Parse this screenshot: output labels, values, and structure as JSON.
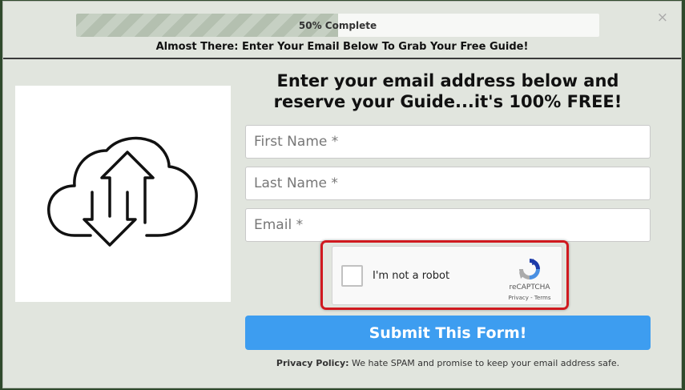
{
  "progress": {
    "label": "50% Complete",
    "percent": 50
  },
  "close_label": "×",
  "subtitle": "Almost There: Enter Your Email Below To Grab Your Free Guide!",
  "image": {
    "icon": "cloud-up-down-arrows-icon"
  },
  "headline": "Enter your email address below and reserve your Guide...it's 100% FREE!",
  "form": {
    "first_name_placeholder": "First Name *",
    "last_name_placeholder": "Last Name *",
    "email_placeholder": "Email *"
  },
  "captcha": {
    "label": "I'm not a robot",
    "brand": "reCAPTCHA",
    "links": "Privacy - Terms",
    "highlight_color": "#d0191f"
  },
  "submit_label": "Submit This Form!",
  "privacy": {
    "label": "Privacy Policy:",
    "text": " We hate SPAM and promise to keep your email address safe."
  },
  "colors": {
    "accent": "#3d9df0",
    "background": "#e1e5de"
  }
}
